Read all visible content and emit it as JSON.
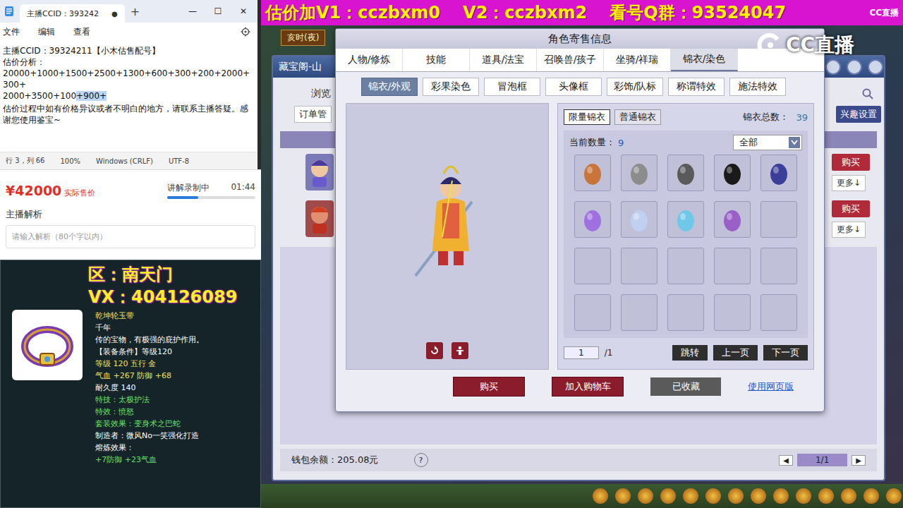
{
  "notepad": {
    "tab_title": "主播CCID：393242",
    "tab_close": "●",
    "new_tab": "+",
    "controls": [
      "—",
      "☐",
      "✕"
    ],
    "menu": [
      "文件",
      "编辑",
      "查看"
    ],
    "lines": [
      "主播CCID：39324211【小木估售配号】",
      "估价分析：",
      "20000+1000+1500+2500+1300+600+300+200+2000+300+"
    ],
    "last_line": "2000+3500+100",
    "highlight": "+900+",
    "note": "估价过程中如有价格异议或者不明白的地方，请联系主播答疑。感谢您使用鉴宝~",
    "status": [
      "行 3，列 66",
      "100%",
      "Windows (CRLF)",
      "UTF-8"
    ]
  },
  "sale": {
    "price": "¥42000",
    "price_label": "实际售价",
    "recording": "讲解录制中",
    "time": "01:44",
    "level": 0.35,
    "analysis_title": "主播解析",
    "placeholder": "请输入解析（80个字以内）"
  },
  "item": {
    "region": "区：南天门",
    "vx": "VX：404126089",
    "name": "乾坤轮玉带",
    "lines": [
      {
        "text": "千年",
        "color": "#ffffff"
      },
      {
        "text": "传的宝物，有极强的庇护作用。",
        "color": "#ffffff"
      },
      {
        "text": "【装备条件】等级120",
        "color": "#ffffff"
      },
      {
        "text": "等级 120 五行 金",
        "color": "#f0e060"
      },
      {
        "text": "气血 +267 防御 +68",
        "color": "#f0e060"
      },
      {
        "text": "耐久度 140",
        "color": "#ffffff"
      },
      {
        "text": "特技：太极护法",
        "color": "#66e066"
      },
      {
        "text": "特效：愤怒",
        "color": "#66e066"
      },
      {
        "text": "套装效果：变身术之巴蛇",
        "color": "#66e066"
      },
      {
        "text": "制造者：微风No一笑强化打造",
        "color": "#ffffff"
      },
      {
        "text": "熔炼效果：",
        "color": "#ffffff"
      },
      {
        "text": "+7防御 +23气血",
        "color": "#66e066"
      }
    ]
  },
  "banner": {
    "parts": [
      "估价加V1：cczbxm0",
      "V2：cczbxm2",
      "看号Q群：93524047"
    ],
    "corner_logo": "CC直播"
  },
  "game": {
    "time_label": "亥时(夜)",
    "stream_logo": "CC直播"
  },
  "bg_window": {
    "title": "藏宝阁-山",
    "nav": [
      "浏览",
      "订单管"
    ],
    "interest": "兴趣设置",
    "rows": [
      {
        "buy": "购买",
        "more": "更多↓"
      },
      {
        "buy": "购买",
        "more": "更多↓"
      }
    ],
    "wallet": "钱包余额：205.08元",
    "help": "?",
    "pager": {
      "prev": "◀",
      "page": "1/1",
      "next": "▶"
    }
  },
  "dialog": {
    "title": "角色寄售信息",
    "tabs": [
      {
        "label": "人物/修炼",
        "selected": false
      },
      {
        "label": "技能",
        "selected": false
      },
      {
        "label": "道具/法宝",
        "selected": false
      },
      {
        "label": "召唤兽/孩子",
        "selected": false
      },
      {
        "label": "坐骑/祥瑞",
        "selected": false
      },
      {
        "label": "锦衣/染色",
        "selected": true
      }
    ],
    "subtabs": [
      {
        "label": "锦衣/外观",
        "selected": true
      },
      {
        "label": "彩果染色",
        "selected": false
      },
      {
        "label": "冒泡框",
        "selected": false
      },
      {
        "label": "头像框",
        "selected": false
      },
      {
        "label": "彩饰/队标",
        "selected": false
      },
      {
        "label": "称谓特效",
        "selected": false
      },
      {
        "label": "施法特效",
        "selected": false
      }
    ],
    "filters": [
      {
        "label": "限量锦衣",
        "selected": true
      },
      {
        "label": "普通锦衣",
        "selected": false
      }
    ],
    "total_label": "锦衣总数：",
    "total": "39",
    "count_label": "当前数量：",
    "count": "9",
    "dropdown": "全部",
    "slots": [
      {
        "filled": true,
        "color": "#c8743a"
      },
      {
        "filled": true,
        "color": "#8c8c8c"
      },
      {
        "filled": true,
        "color": "#5a5a5a"
      },
      {
        "filled": true,
        "color": "#1a1a1a"
      },
      {
        "filled": true,
        "color": "#3b3f9a"
      },
      {
        "filled": true,
        "color": "#a070e0"
      },
      {
        "filled": true,
        "color": "#c0d0f0"
      },
      {
        "filled": true,
        "color": "#70c8e8"
      },
      {
        "filled": true,
        "color": "#9a60c8"
      },
      {
        "filled": false
      },
      {
        "filled": false
      },
      {
        "filled": false
      },
      {
        "filled": false
      },
      {
        "filled": false
      },
      {
        "filled": false
      },
      {
        "filled": false
      },
      {
        "filled": false
      },
      {
        "filled": false
      },
      {
        "filled": false
      },
      {
        "filled": false
      }
    ],
    "page": "1",
    "page_total": "/1",
    "jump": "跳转",
    "prev": "上一页",
    "next": "下一页",
    "actions": [
      {
        "label": "购买",
        "kind": "primary"
      },
      {
        "label": "加入购物车",
        "kind": "primary"
      },
      {
        "label": "已收藏",
        "kind": "muted"
      },
      {
        "label": "使用网页版",
        "kind": "link"
      }
    ]
  }
}
